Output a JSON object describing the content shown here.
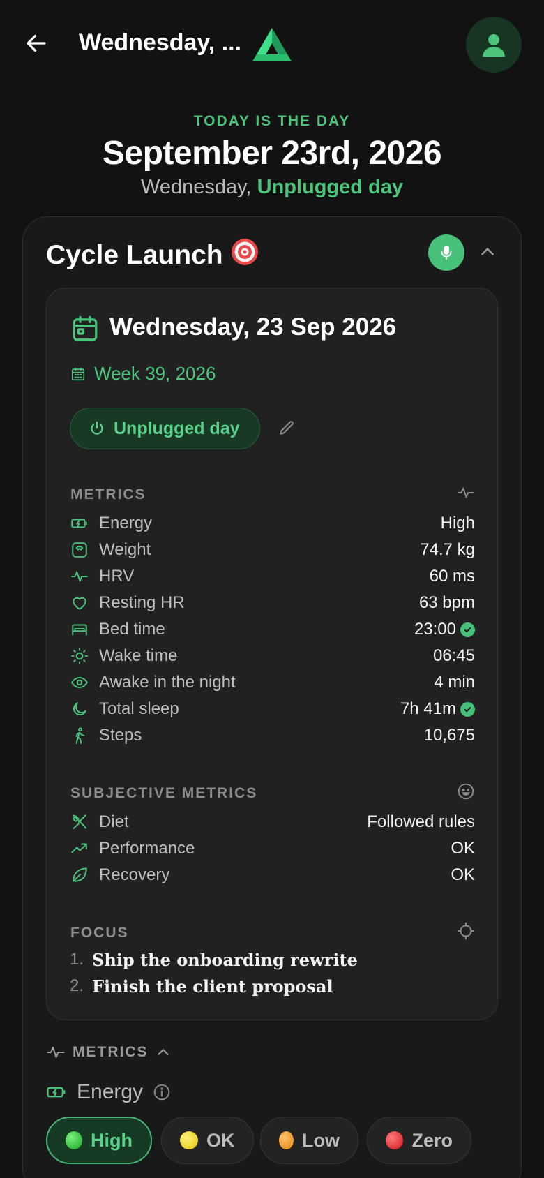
{
  "header": {
    "title": "Wednesday, ...",
    "back_icon": "arrow-left-icon",
    "logo_icon": "triangle-logo-icon",
    "avatar_icon": "user-icon"
  },
  "hero": {
    "eyebrow": "TODAY IS THE DAY",
    "date": "September 23rd, 2026",
    "weekday": "Wednesday,",
    "day_type": "Unplugged day"
  },
  "cycle": {
    "title": "Cycle Launch",
    "emoji": "🎯"
  },
  "day": {
    "title": "Wednesday, 23 Sep 2026",
    "week": "Week 39, 2026",
    "day_type_label": "Unplugged day"
  },
  "metrics": {
    "heading": "METRICS",
    "items": [
      {
        "label": "Energy",
        "value": "High",
        "icon": "battery-icon"
      },
      {
        "label": "Weight",
        "value": "74.7 kg",
        "icon": "scale-icon"
      },
      {
        "label": "HRV",
        "value": "60 ms",
        "icon": "pulse-icon"
      },
      {
        "label": "Resting HR",
        "value": "63 bpm",
        "icon": "heart-icon"
      },
      {
        "label": "Bed time",
        "value": "23:00",
        "icon": "bed-icon",
        "check": true
      },
      {
        "label": "Wake time",
        "value": "06:45",
        "icon": "sun-icon"
      },
      {
        "label": "Awake in the night",
        "value": "4 min",
        "icon": "eye-icon"
      },
      {
        "label": "Total sleep",
        "value": "7h 41m",
        "icon": "moon-icon",
        "check": true
      },
      {
        "label": "Steps",
        "value": "10,675",
        "icon": "walking-icon"
      }
    ]
  },
  "subjective": {
    "heading": "SUBJECTIVE METRICS",
    "items": [
      {
        "label": "Diet",
        "value": "Followed rules",
        "icon": "utensils-icon"
      },
      {
        "label": "Performance",
        "value": "OK",
        "icon": "trending-up-icon"
      },
      {
        "label": "Recovery",
        "value": "OK",
        "icon": "leaf-icon"
      }
    ]
  },
  "focus": {
    "heading": "FOCUS",
    "items": [
      {
        "num": "1.",
        "text": "Ship the onboarding rewrite"
      },
      {
        "num": "2.",
        "text": "Finish the client proposal"
      }
    ]
  },
  "metrics_section": {
    "heading": "METRICS",
    "energy_label": "Energy"
  },
  "energy_options": [
    {
      "label": "High",
      "color": "#1fc02a",
      "active": true
    },
    {
      "label": "OK",
      "color": "#f5d31a",
      "active": false
    },
    {
      "label": "Low",
      "color": "#f29a1a",
      "active": false
    },
    {
      "label": "Zero",
      "color": "#e8262b",
      "active": false
    }
  ]
}
